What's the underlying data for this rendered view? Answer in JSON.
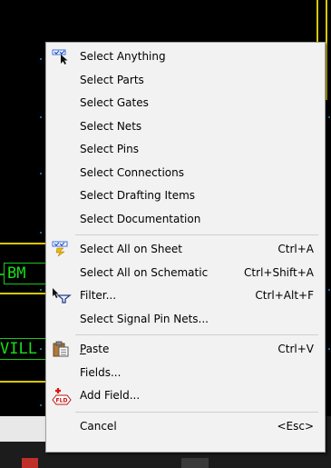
{
  "canvas": {
    "net_labels": [
      "BM",
      "VILL"
    ]
  },
  "menu": {
    "groups": [
      [
        {
          "label": "Select Anything",
          "icon": "select-arrow-icon"
        },
        {
          "label": "Select Parts"
        },
        {
          "label": "Select Gates"
        },
        {
          "label": "Select Nets"
        },
        {
          "label": "Select Pins"
        },
        {
          "label": "Select Connections"
        },
        {
          "label": "Select Drafting Items"
        },
        {
          "label": "Select Documentation"
        }
      ],
      [
        {
          "label": "Select All on Sheet",
          "shortcut": "Ctrl+A",
          "icon": "select-all-icon"
        },
        {
          "label": "Select All on Schematic",
          "shortcut": "Ctrl+Shift+A"
        },
        {
          "label": "Filter...",
          "shortcut": "Ctrl+Alt+F",
          "icon": "filter-icon"
        },
        {
          "label": "Select Signal Pin Nets..."
        }
      ],
      [
        {
          "label": "Paste",
          "shortcut": "Ctrl+V",
          "icon": "paste-icon"
        },
        {
          "label": "Fields..."
        },
        {
          "label": "Add Field...",
          "icon": "add-field-icon"
        }
      ],
      [
        {
          "label": "Cancel",
          "shortcut": "<Esc>"
        }
      ]
    ]
  },
  "colors": {
    "menu_bg": "#f2f2f2",
    "canvas_bg": "#000000",
    "wire": "#d8c800",
    "net": "#18c818"
  }
}
